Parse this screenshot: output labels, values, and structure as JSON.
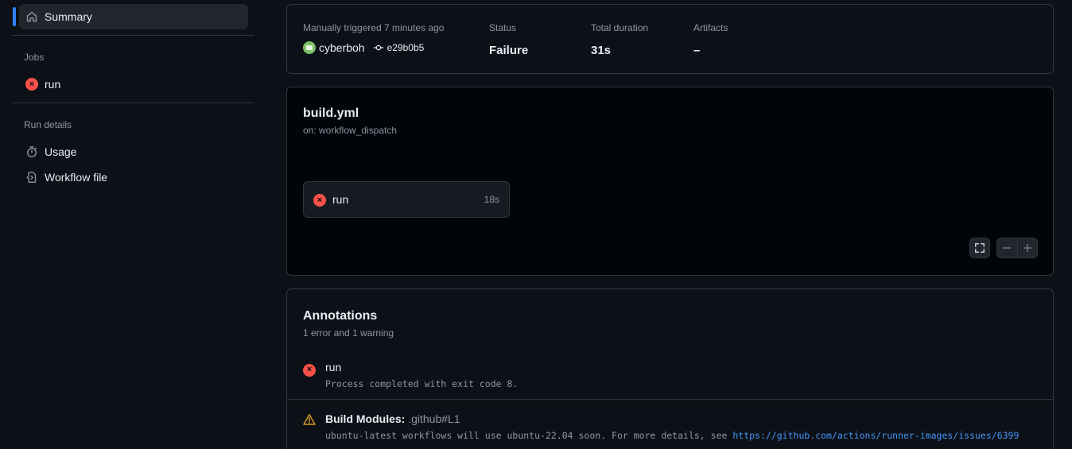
{
  "sidebar": {
    "summary_label": "Summary",
    "jobs_heading": "Jobs",
    "job_run_label": "run",
    "run_details_heading": "Run details",
    "usage_label": "Usage",
    "workflow_file_label": "Workflow file"
  },
  "summary": {
    "trigger_label": "Manually triggered 7 minutes ago",
    "actor": "cyberboh",
    "commit": "e29b0b5",
    "status_label": "Status",
    "status_value": "Failure",
    "duration_label": "Total duration",
    "duration_value": "31s",
    "artifacts_label": "Artifacts",
    "artifacts_value": "–"
  },
  "graph": {
    "title": "build.yml",
    "subtitle": "on: workflow_dispatch",
    "job_name": "run",
    "job_duration": "18s"
  },
  "annotations": {
    "title": "Annotations",
    "subtitle": "1 error and 1 warning",
    "error_title": "run",
    "error_message": "Process completed with exit code 8.",
    "warning_title": "Build Modules:",
    "warning_location": ".github#L1",
    "warning_message": "ubuntu-latest workflows will use ubuntu-22.04 soon. For more details, see ",
    "warning_link": "https://github.com/actions/runner-images/issues/6399"
  },
  "colors": {
    "background": "#0d1117",
    "error": "#f85149",
    "warning": "#d29922",
    "accent": "#2f81f7",
    "link": "#4493f8"
  },
  "icons": [
    "home-icon",
    "x-circle-icon",
    "stopwatch-icon",
    "file-code-icon",
    "git-commit-icon",
    "fullscreen-icon",
    "minus-icon",
    "plus-icon",
    "alert-icon"
  ]
}
